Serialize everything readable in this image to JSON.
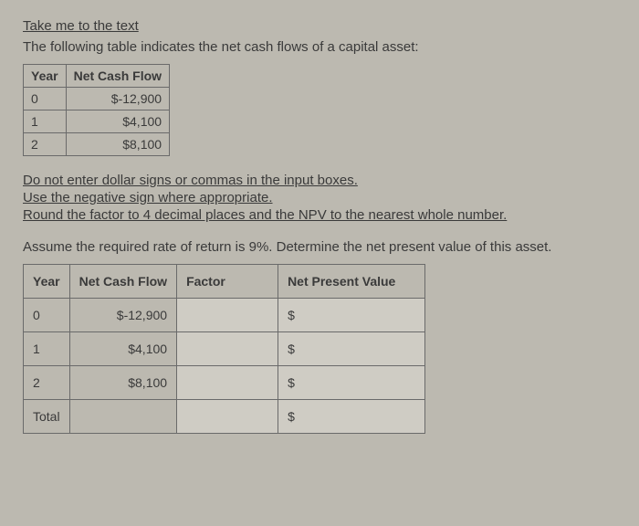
{
  "header": {
    "link": "Take me to the text",
    "intro": "The following table indicates the net cash flows of a capital asset:"
  },
  "cashflow_table": {
    "head_year": "Year",
    "head_flow": "Net Cash Flow",
    "rows": [
      {
        "year": "0",
        "flow": "$-12,900"
      },
      {
        "year": "1",
        "flow": "$4,100"
      },
      {
        "year": "2",
        "flow": "$8,100"
      }
    ]
  },
  "instructions": {
    "line1": "Do not enter dollar signs or commas in the input boxes.",
    "line2": "Use the negative sign where appropriate.",
    "line3": "Round the factor to 4 decimal places and the NPV to the nearest whole number."
  },
  "assume": "Assume the required rate of return is 9%. Determine the net present value of this asset.",
  "npv_table": {
    "head_year": "Year",
    "head_flow": "Net Cash Flow",
    "head_factor": "Factor",
    "head_npv": "Net Present Value",
    "dollar": "$",
    "rows": [
      {
        "year": "0",
        "flow": "$-12,900"
      },
      {
        "year": "1",
        "flow": "$4,100"
      },
      {
        "year": "2",
        "flow": "$8,100"
      }
    ],
    "total_label": "Total"
  }
}
